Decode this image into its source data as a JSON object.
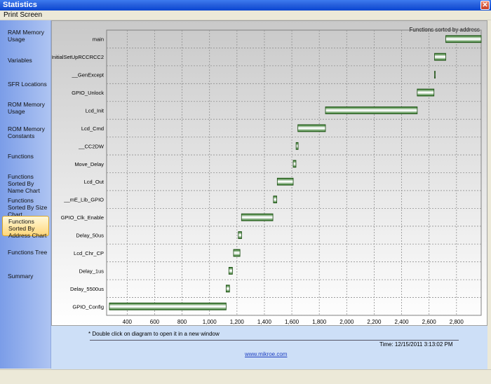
{
  "window": {
    "title": "Statistics",
    "close_icon": "close-icon"
  },
  "menu": {
    "print_screen": "Print Screen"
  },
  "sidebar": {
    "items": [
      {
        "label": "RAM Memory Usage",
        "active": false
      },
      {
        "label": "Variables",
        "active": false
      },
      {
        "label": "SFR Locations",
        "active": false
      },
      {
        "label": "ROM Memory Usage",
        "active": false
      },
      {
        "label": "ROM Memory Constants",
        "active": false
      },
      {
        "label": "Functions",
        "active": false
      },
      {
        "label": "Functions Sorted By Name Chart",
        "active": false
      },
      {
        "label": "Functions Sorted By Size Chart",
        "active": false
      },
      {
        "label": "Functions Sorted By Address Chart",
        "active": true
      },
      {
        "label": "Functions Tree",
        "active": false
      },
      {
        "label": "Summary",
        "active": false
      }
    ]
  },
  "chart_data": {
    "type": "bar",
    "orientation": "horizontal-range",
    "title": "Functions sorted by address",
    "grid": true,
    "xlim": [
      250,
      2980
    ],
    "x_ticks": [
      "400",
      "600",
      "800",
      "1,000",
      "1,200",
      "1,400",
      "1,600",
      "1,800",
      "2,000",
      "2,200",
      "2,400",
      "2,600",
      "2,800"
    ],
    "x_tick_values": [
      400,
      600,
      800,
      1000,
      1200,
      1400,
      1600,
      1800,
      2000,
      2200,
      2400,
      2600,
      2800
    ],
    "categories": [
      "main",
      "InitialSetUpRCCRCC2",
      "__GenExcept",
      "GPIO_Unlock",
      "Lcd_Init",
      "Lcd_Cmd",
      "__CC2DW",
      "Move_Delay",
      "Lcd_Out",
      "__mE_Lib_GPIO",
      "GPIO_Clk_Enable",
      "Delay_50us",
      "Lcd_Chr_CP",
      "Delay_1us",
      "Delay_5500us",
      "GPIO_Config"
    ],
    "series": [
      {
        "start": [
          2722,
          2640,
          2640,
          2514,
          1845,
          1644,
          1631,
          1610,
          1494,
          1466,
          1233,
          1210,
          1175,
          1141,
          1121,
          270
        ],
        "end": [
          2980,
          2722,
          2641,
          2636,
          2514,
          1845,
          1646,
          1630,
          1610,
          1490,
          1462,
          1234,
          1222,
          1167,
          1146,
          1121
        ],
        "color": "#2e7d1e"
      }
    ],
    "note": "* Double click on diagram to open it in a new window"
  },
  "footer": {
    "time": "Time: 12/15/2011 3:13:02 PM",
    "url": "www.mikroe.com"
  }
}
